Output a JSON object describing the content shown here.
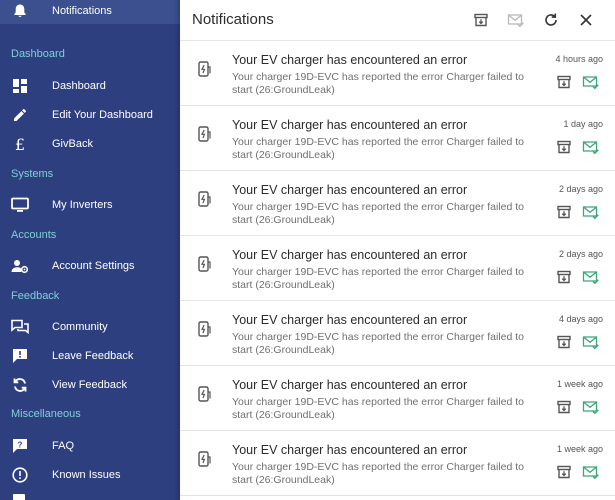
{
  "sidebar": {
    "notifications_label": "Notifications",
    "sections": {
      "dashboard": "Dashboard",
      "systems": "Systems",
      "accounts": "Accounts",
      "feedback": "Feedback",
      "misc": "Miscellaneous"
    },
    "items": {
      "dashboard": "Dashboard",
      "edit_dashboard": "Edit Your Dashboard",
      "givback": "GivBack",
      "inverters": "My Inverters",
      "account_settings": "Account Settings",
      "community": "Community",
      "leave_feedback": "Leave Feedback",
      "view_feedback": "View Feedback",
      "faq": "FAQ",
      "known_issues": "Known Issues"
    }
  },
  "panel": {
    "title": "Notifications"
  },
  "notifications": [
    {
      "title": "Your EV charger has encountered an error",
      "body": "Your charger 19D-EVC has reported the error Charger failed to start (26:GroundLeak)",
      "time": "4 hours ago"
    },
    {
      "title": "Your EV charger has encountered an error",
      "body": "Your charger 19D-EVC has reported the error Charger failed to start (26:GroundLeak)",
      "time": "1 day ago"
    },
    {
      "title": "Your EV charger has encountered an error",
      "body": "Your charger 19D-EVC has reported the error Charger failed to start (26:GroundLeak)",
      "time": "2 days ago"
    },
    {
      "title": "Your EV charger has encountered an error",
      "body": "Your charger 19D-EVC has reported the error Charger failed to start (26:GroundLeak)",
      "time": "2 days ago"
    },
    {
      "title": "Your EV charger has encountered an error",
      "body": "Your charger 19D-EVC has reported the error Charger failed to start (26:GroundLeak)",
      "time": "4 days ago"
    },
    {
      "title": "Your EV charger has encountered an error",
      "body": "Your charger 19D-EVC has reported the error Charger failed to start (26:GroundLeak)",
      "time": "1 week ago"
    },
    {
      "title": "Your EV charger has encountered an error",
      "body": "Your charger 19D-EVC has reported the error Charger failed to start (26:GroundLeak)",
      "time": "1 week ago"
    }
  ],
  "colors": {
    "sidebar_bg": "#2e3f80",
    "section_label": "#7fd0d6",
    "mark_read_icon": "#3aa67a"
  },
  "icons": {
    "header": [
      "archive-all-icon",
      "mark-all-read-icon",
      "refresh-icon",
      "close-icon"
    ],
    "item": [
      "ev-charger-icon",
      "archive-icon",
      "mark-read-icon"
    ]
  }
}
